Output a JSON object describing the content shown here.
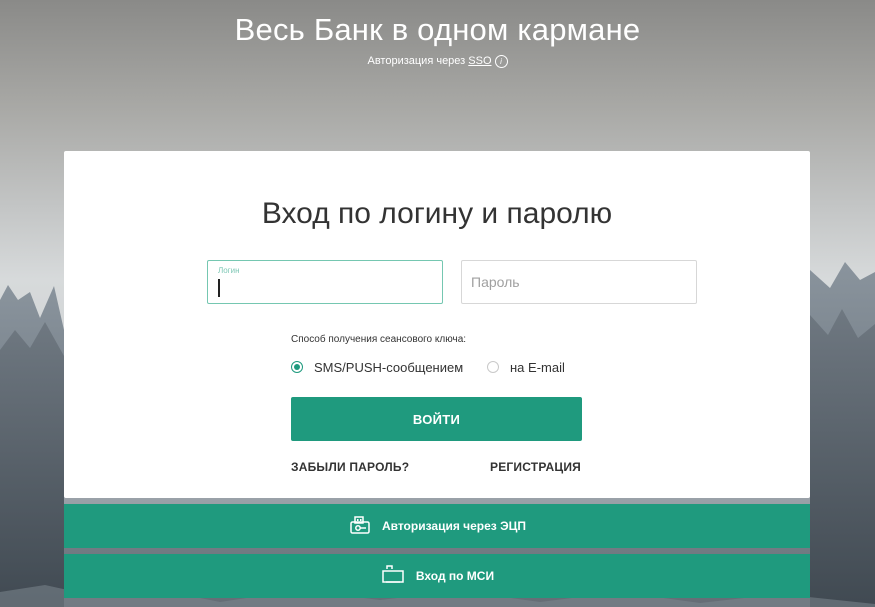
{
  "header": {
    "title": "Весь Банк в одном кармане",
    "sso_prefix": "Авторизация через ",
    "sso_link": "SSO",
    "info_icon": "info-icon"
  },
  "login_form": {
    "title": "Вход по логину и паролю",
    "login_label": "Логин",
    "login_value": "",
    "password_placeholder": "Пароль",
    "method_label": "Способ получения сеансового ключа:",
    "method_sms": "SMS/PUSH-сообщением",
    "method_email": "на E-mail",
    "selected_method": "SMS/PUSH-сообщением",
    "submit": "ВОЙТИ",
    "forgot_password": "ЗАБЫЛИ ПАРОЛЬ?",
    "register": "РЕГИСТРАЦИЯ"
  },
  "alternative_auth": {
    "ecp_label": "Авторизация через ЭЦП",
    "ecp_icon": "usb-token-icon",
    "msi_label": "Вход по МСИ",
    "msi_icon": "smart-card-icon"
  },
  "colors": {
    "accent": "#1f9a7e",
    "text": "#333333",
    "muted": "#a0a0a0",
    "background": "#d6d9da"
  }
}
